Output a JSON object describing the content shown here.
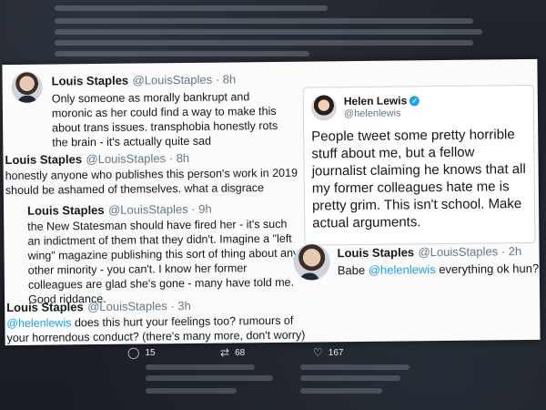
{
  "tweet1": {
    "name": "Louis Staples",
    "handle_time": "@LouisStaples · 8h",
    "text": "Only someone as morally bankrupt and moronic as her could find a way to make this about trans issues. transphobia honestly rots the brain - it's actually quite sad"
  },
  "tweet2": {
    "name": "Louis Staples",
    "handle_time": "@LouisStaples · 8h",
    "text": "honestly anyone who publishes this person's work in 2019 should be ashamed of themselves. what a disgrace"
  },
  "tweet3": {
    "name": "Louis Staples",
    "handle_time": "@LouisStaples · 9h",
    "text": "the New Statesman should have fired her - it's such an indictment of them that they didn't. Imagine a \"left wing\" magazine publishing this sort of thing about any other minority - you can't. I know her former colleagues are glad she's gone - many have told me. Good riddance."
  },
  "tweet4": {
    "name": "Louis Staples",
    "handle_time": "@LouisStaples · 3h",
    "mention": "@helenlewis",
    "text": " does this hurt your feelings too? rumours of your horrendous conduct? (there's many more, don't worry)"
  },
  "quote": {
    "name": "Helen Lewis",
    "handle": "@helenlewis",
    "text": "People tweet some pretty horrible stuff about me, but a fellow journalist claiming he knows that all my former colleagues hate me is pretty grim. This isn't school. Make actual arguments."
  },
  "tweet5": {
    "name": "Louis Staples",
    "handle_time": "@LouisStaples · 2h",
    "prefix": "Babe ",
    "mention": "@helenlewis",
    "suffix": " everything ok hun?"
  },
  "actions": {
    "reply_count": "15",
    "retweet_count": "68",
    "like_count": "167",
    "reply_icon": "reply-icon",
    "retweet_icon": "retweet-icon",
    "like_icon": "heart-icon"
  },
  "colors": {
    "link": "#1da1f2",
    "card": "#fbfbfb",
    "background": "#1d2127"
  }
}
